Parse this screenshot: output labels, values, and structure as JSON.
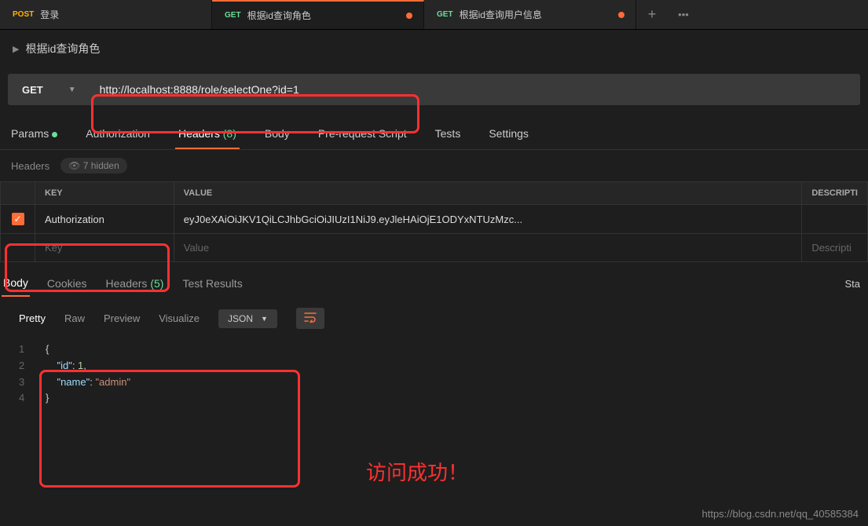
{
  "tabs": [
    {
      "method": "POST",
      "name": "登录",
      "dot": false
    },
    {
      "method": "GET",
      "name": "根据id查询角色",
      "dot": true,
      "active": true
    },
    {
      "method": "GET",
      "name": "根据id查询用户信息",
      "dot": true
    }
  ],
  "breadcrumb": "根据id查询角色",
  "request": {
    "method": "GET",
    "url": "http://localhost:8888/role/selectOne?id=1"
  },
  "reqTabs": {
    "params": "Params",
    "authorization": "Authorization",
    "headers": "Headers",
    "headersCount": "(8)",
    "body": "Body",
    "prerequest": "Pre-request Script",
    "tests": "Tests",
    "settings": "Settings"
  },
  "headersSection": {
    "label": "Headers",
    "hiddenText": "7 hidden",
    "columns": {
      "key": "KEY",
      "value": "VALUE",
      "desc": "DESCRIPTI"
    },
    "rows": [
      {
        "checked": true,
        "key": "Authorization",
        "value": "eyJ0eXAiOiJKV1QiLCJhbGciOiJIUzI1NiJ9.eyJleHAiOjE1ODYxNTUzMzc..."
      }
    ],
    "placeholders": {
      "key": "Key",
      "value": "Value",
      "desc": "Descripti"
    }
  },
  "respTabs": {
    "body": "Body",
    "cookies": "Cookies",
    "headers": "Headers",
    "headersCount": "(5)",
    "testResults": "Test Results",
    "status": "Sta"
  },
  "viewer": {
    "pretty": "Pretty",
    "raw": "Raw",
    "preview": "Preview",
    "visualize": "Visualize",
    "format": "JSON"
  },
  "responseBody": {
    "id_key": "\"id\"",
    "id_val": "1",
    "name_key": "\"name\"",
    "name_val": "\"admin\""
  },
  "annotations": {
    "successText": "访问成功！"
  },
  "watermark": "https://blog.csdn.net/qq_40585384"
}
